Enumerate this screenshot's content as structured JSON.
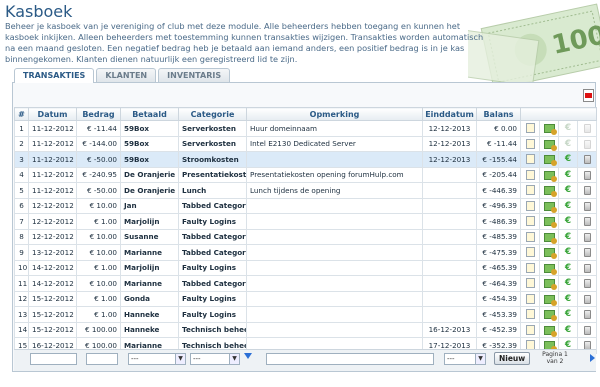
{
  "header": {
    "title": "Kasboek",
    "intro": "Beheer je kasboek van je vereniging of club met deze module. Alle beheerders hebben toegang en kunnen het kasboek inkijken. Alleen beheerders met toestemming kunnen transakties wijzigen. Transakties worden automatisch na een maand gesloten. Een negatief bedrag heb je betaald aan iemand anders, een positief bedrag is in je kas binnengekomen. Klanten dienen natuurlijk een geregistreerd lid te zijn.",
    "banknote_text": "100"
  },
  "tabs": [
    {
      "label": "TRANSAKTIES",
      "active": true
    },
    {
      "label": "KLANTEN",
      "active": false
    },
    {
      "label": "INVENTARIS",
      "active": false
    }
  ],
  "columns": [
    "#",
    "Datum",
    "Bedrag",
    "Betaald",
    "Categorie",
    "Opmerking",
    "Einddatum",
    "Balans"
  ],
  "rows": [
    {
      "n": "1",
      "datum": "11-12-2012",
      "bedrag": "€ -11.44",
      "betaald": "59Box",
      "categorie": "Serverkosten",
      "opmerking": "Huur domeinnaam",
      "einddatum": "12-12-2013",
      "balans": "€ 0.00"
    },
    {
      "n": "2",
      "datum": "11-12-2012",
      "bedrag": "€ -144.00",
      "betaald": "59Box",
      "categorie": "Serverkosten",
      "opmerking": "Intel E2130 Dedicated Server",
      "einddatum": "12-12-2013",
      "balans": "€ -11.44"
    },
    {
      "n": "3",
      "datum": "11-12-2012",
      "bedrag": "€ -50.00",
      "betaald": "59Box",
      "categorie": "Stroomkosten",
      "opmerking": "",
      "einddatum": "12-12-2013",
      "balans": "€ -155.44"
    },
    {
      "n": "4",
      "datum": "11-12-2012",
      "bedrag": "€ -240.95",
      "betaald": "De Oranjerie",
      "categorie": "Presentatiekosten",
      "opmerking": "Presentatiekosten opening forumHulp.com",
      "einddatum": "",
      "balans": "€ -205.44"
    },
    {
      "n": "5",
      "datum": "11-12-2012",
      "bedrag": "€ -50.00",
      "betaald": "De Oranjerie",
      "categorie": "Lunch",
      "opmerking": "Lunch tijdens de opening",
      "einddatum": "",
      "balans": "€ -446.39"
    },
    {
      "n": "6",
      "datum": "12-12-2012",
      "bedrag": "€ 10.00",
      "betaald": "Jan",
      "categorie": "Tabbed Categorys",
      "opmerking": "",
      "einddatum": "",
      "balans": "€ -496.39"
    },
    {
      "n": "7",
      "datum": "12-12-2012",
      "bedrag": "€ 1.00",
      "betaald": "Marjolijn",
      "categorie": "Faulty Logins",
      "opmerking": "",
      "einddatum": "",
      "balans": "€ -486.39"
    },
    {
      "n": "8",
      "datum": "12-12-2012",
      "bedrag": "€ 10.00",
      "betaald": "Susanne",
      "categorie": "Tabbed Categorys",
      "opmerking": "",
      "einddatum": "",
      "balans": "€ -485.39"
    },
    {
      "n": "9",
      "datum": "13-12-2012",
      "bedrag": "€ 10.00",
      "betaald": "Marianne",
      "categorie": "Tabbed Categorys",
      "opmerking": "",
      "einddatum": "",
      "balans": "€ -475.39"
    },
    {
      "n": "10",
      "datum": "14-12-2012",
      "bedrag": "€ 1.00",
      "betaald": "Marjolijn",
      "categorie": "Faulty Logins",
      "opmerking": "",
      "einddatum": "",
      "balans": "€ -465.39"
    },
    {
      "n": "11",
      "datum": "14-12-2012",
      "bedrag": "€ 10.00",
      "betaald": "Marianne",
      "categorie": "Tabbed Categorys",
      "opmerking": "",
      "einddatum": "",
      "balans": "€ -464.39"
    },
    {
      "n": "12",
      "datum": "15-12-2012",
      "bedrag": "€ 1.00",
      "betaald": "Gonda",
      "categorie": "Faulty Logins",
      "opmerking": "",
      "einddatum": "",
      "balans": "€ -454.39"
    },
    {
      "n": "13",
      "datum": "15-12-2012",
      "bedrag": "€ 1.00",
      "betaald": "Hanneke",
      "categorie": "Faulty Logins",
      "opmerking": "",
      "einddatum": "",
      "balans": "€ -453.39"
    },
    {
      "n": "14",
      "datum": "15-12-2012",
      "bedrag": "€ 100.00",
      "betaald": "Hanneke",
      "categorie": "Technisch beheer",
      "opmerking": "",
      "einddatum": "16-12-2013",
      "balans": "€ -452.39"
    },
    {
      "n": "15",
      "datum": "16-12-2012",
      "bedrag": "€ 100.00",
      "betaald": "Marianne",
      "categorie": "Technisch beheer",
      "opmerking": "",
      "einddatum": "17-12-2013",
      "balans": "€ -352.39"
    }
  ],
  "filters": {
    "select_value": "---",
    "new_button": "Nieuw",
    "pager": "Pagina 1 van 2"
  },
  "colors": {
    "negative": "#e33a2d",
    "accent": "#2b5a86",
    "selected_row": "#dbeaf8"
  }
}
